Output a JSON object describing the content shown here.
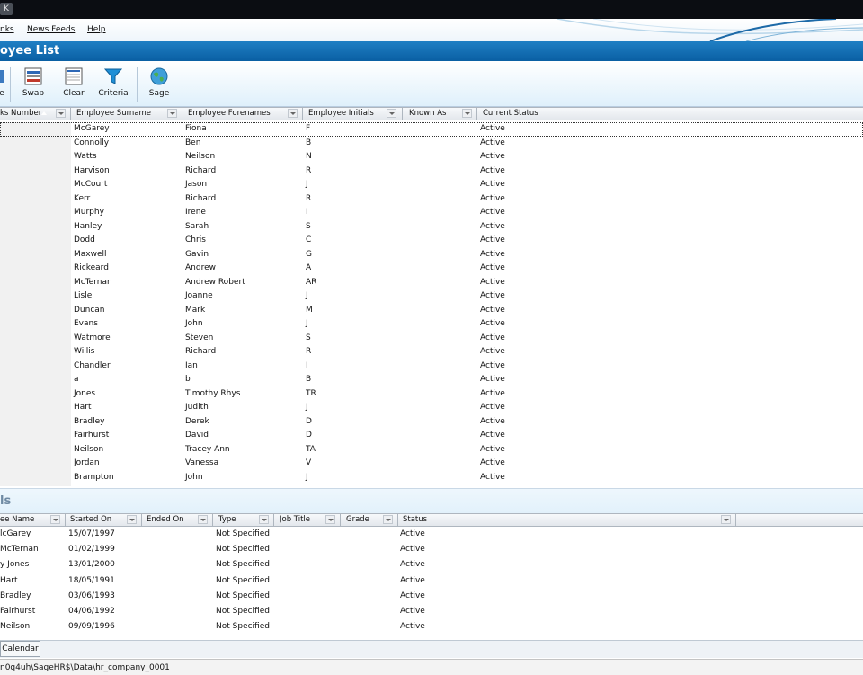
{
  "titlebar": {
    "glyph": "K"
  },
  "menu": {
    "items": [
      "nks",
      "News Feeds",
      "Help"
    ]
  },
  "window": {
    "title": "oyee List"
  },
  "toolbar": {
    "buttons": [
      "e",
      "Swap",
      "Clear",
      "Criteria",
      "Sage"
    ]
  },
  "employee_grid": {
    "columns": [
      "ks Number",
      "Employee Surname",
      "Employee Forenames",
      "Employee Initials",
      "Known As",
      "Current Status"
    ],
    "rows": [
      [
        "McGarey",
        "Fiona",
        "F",
        "Active"
      ],
      [
        "Connolly",
        "Ben",
        "B",
        "Active"
      ],
      [
        "Watts",
        "Neilson",
        "N",
        "Active"
      ],
      [
        "Harvison",
        "Richard",
        "R",
        "Active"
      ],
      [
        "McCourt",
        "Jason",
        "J",
        "Active"
      ],
      [
        "Kerr",
        "Richard",
        "R",
        "Active"
      ],
      [
        "Murphy",
        "Irene",
        "I",
        "Active"
      ],
      [
        "Hanley",
        "Sarah",
        "S",
        "Active"
      ],
      [
        "Dodd",
        "Chris",
        "C",
        "Active"
      ],
      [
        "Maxwell",
        "Gavin",
        "G",
        "Active"
      ],
      [
        "Rickeard",
        "Andrew",
        "A",
        "Active"
      ],
      [
        "McTernan",
        "Andrew Robert",
        "AR",
        "Active"
      ],
      [
        "Lisle",
        "Joanne",
        "J",
        "Active"
      ],
      [
        "Duncan",
        "Mark",
        "M",
        "Active"
      ],
      [
        "Evans",
        "John",
        "J",
        "Active"
      ],
      [
        "Watmore",
        "Steven",
        "S",
        "Active"
      ],
      [
        "Willis",
        "Richard",
        "R",
        "Active"
      ],
      [
        "Chandler",
        "Ian",
        "I",
        "Active"
      ],
      [
        "a",
        "b",
        "B",
        "Active"
      ],
      [
        "Jones",
        "Timothy Rhys",
        "TR",
        "Active"
      ],
      [
        "Hart",
        "Judith",
        "J",
        "Active"
      ],
      [
        "Bradley",
        "Derek",
        "D",
        "Active"
      ],
      [
        "Fairhurst",
        "David",
        "D",
        "Active"
      ],
      [
        "Neilson",
        "Tracey Ann",
        "TA",
        "Active"
      ],
      [
        "Jordan",
        "Vanessa",
        "V",
        "Active"
      ],
      [
        "Brampton",
        "John",
        "J",
        "Active"
      ]
    ]
  },
  "details": {
    "title": "ls",
    "columns": [
      "ee Name",
      "Started On",
      "Ended On",
      "Type",
      "Job Title",
      "Grade",
      "Status"
    ],
    "rows": [
      [
        "lcGarey",
        "15/07/1997",
        "",
        "Not Specified",
        "",
        "",
        "Active"
      ],
      [
        " McTernan",
        "01/02/1999",
        "",
        "Not Specified",
        "",
        "",
        "Active"
      ],
      [
        "y Jones",
        "13/01/2000",
        "",
        "Not Specified",
        "",
        "",
        "Active"
      ],
      [
        "Hart",
        "18/05/1991",
        "",
        "Not Specified",
        "",
        "",
        "Active"
      ],
      [
        "Bradley",
        "03/06/1993",
        "",
        "Not Specified",
        "",
        "",
        "Active"
      ],
      [
        "Fairhurst",
        "04/06/1992",
        "",
        "Not Specified",
        "",
        "",
        "Active"
      ],
      [
        " Neilson",
        "09/09/1996",
        "",
        "Not Specified",
        "",
        "",
        "Active"
      ]
    ]
  },
  "tabs": [
    "Calendar"
  ],
  "status": {
    "path": "n0q4uh\\SageHR$\\Data\\hr_company_0001"
  }
}
